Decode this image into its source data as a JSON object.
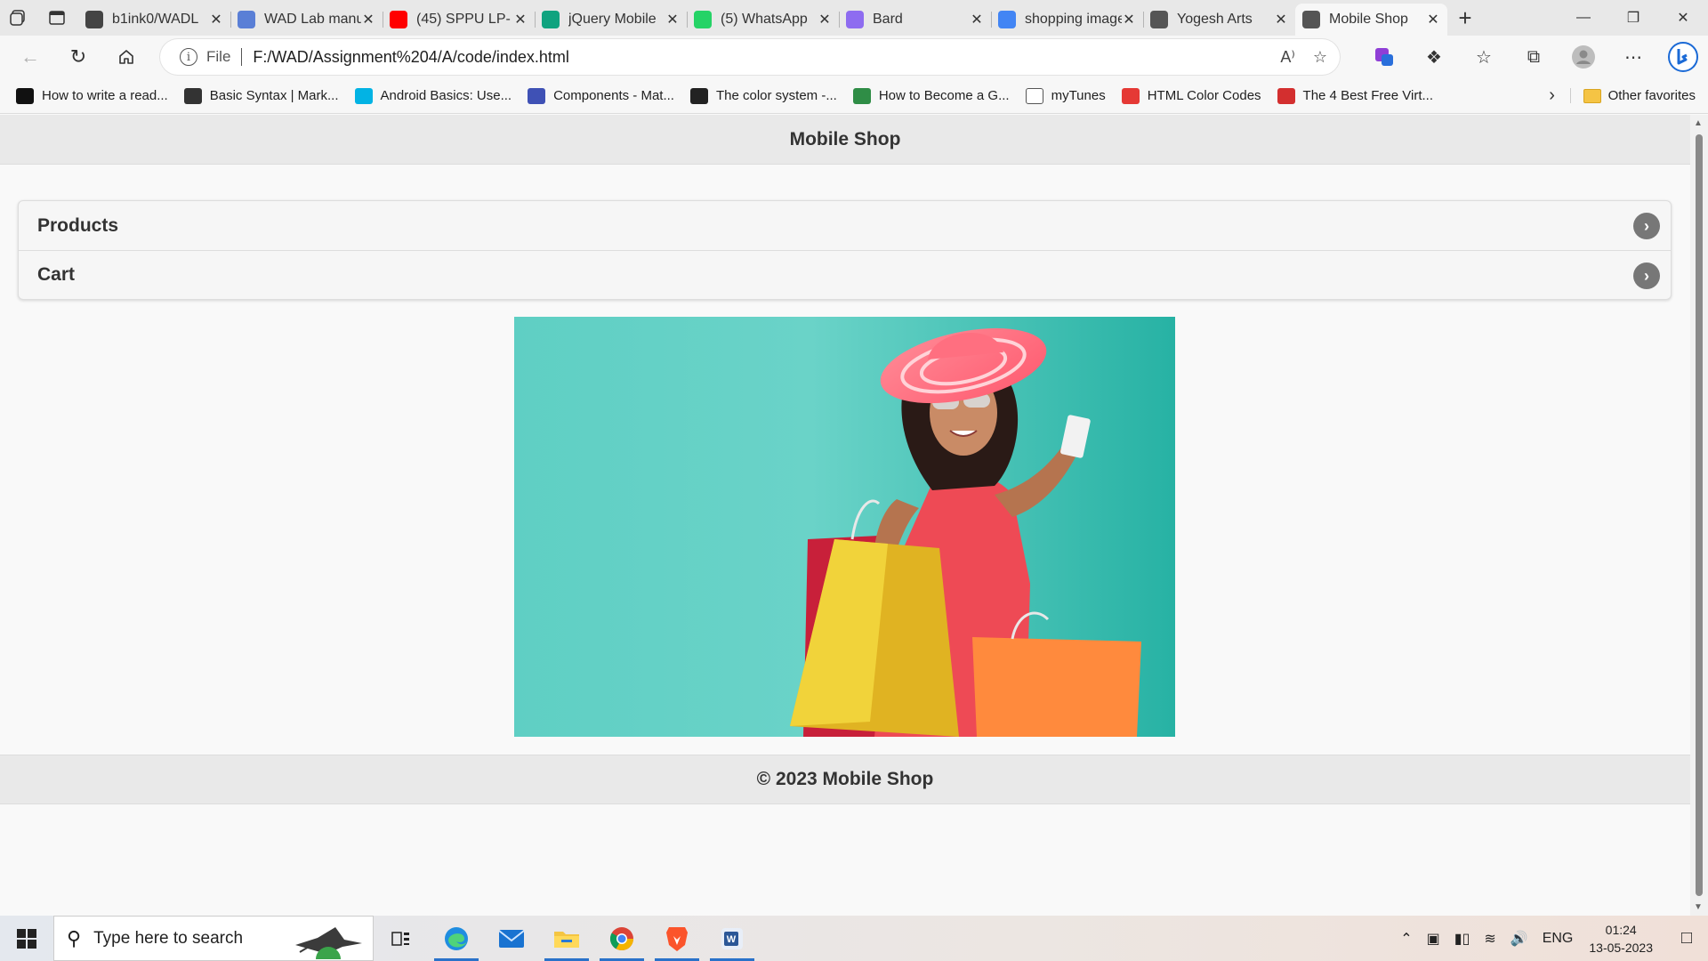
{
  "browser": {
    "tabs": [
      {
        "title": "b1ink0/WADL",
        "icon": "github-icon",
        "color": "#444444"
      },
      {
        "title": "WAD Lab manual",
        "icon": "contacts-icon",
        "color": "#5a7fd6"
      },
      {
        "title": "(45) SPPU LP-",
        "icon": "youtube-icon",
        "color": "#ff0000"
      },
      {
        "title": "jQuery Mobile",
        "icon": "chatgpt-icon",
        "color": "#10a37f"
      },
      {
        "title": "(5) WhatsApp",
        "icon": "whatsapp-icon",
        "color": "#25d366"
      },
      {
        "title": "Bard",
        "icon": "bard-icon",
        "color": "#8e6cf0"
      },
      {
        "title": "shopping images",
        "icon": "google-icon",
        "color": "#4285f4"
      },
      {
        "title": "Yogesh Arts",
        "icon": "page-icon",
        "color": "#555555"
      },
      {
        "title": "Mobile Shop",
        "icon": "page-icon",
        "color": "#555555",
        "active": true
      }
    ],
    "address": {
      "scheme": "File",
      "url": "F:/WAD/Assignment%204/A/code/index.html"
    },
    "favorites": [
      {
        "label": "How to write a read...",
        "icon": "readme-icon"
      },
      {
        "label": "Basic Syntax | Mark...",
        "icon": "markdown-icon"
      },
      {
        "label": "Android Basics: Use...",
        "icon": "udacity-icon"
      },
      {
        "label": "Components - Mat...",
        "icon": "material-icon"
      },
      {
        "label": "The color system -...",
        "icon": "github-icon"
      },
      {
        "label": "How to Become a G...",
        "icon": "gfg-icon"
      },
      {
        "label": "myTunes",
        "icon": "page-icon"
      },
      {
        "label": "HTML Color Codes",
        "icon": "color-icon"
      },
      {
        "label": "The 4 Best Free Virt...",
        "icon": "vpn-icon"
      }
    ],
    "other_favorites": "Other favorites"
  },
  "page": {
    "header_title": "Mobile Shop",
    "list_items": [
      {
        "label": "Products"
      },
      {
        "label": "Cart"
      }
    ],
    "footer_text": "© 2023 Mobile Shop"
  },
  "taskbar": {
    "search_placeholder": "Type here to search",
    "language": "ENG",
    "time": "01:24",
    "date": "13-05-2023"
  }
}
